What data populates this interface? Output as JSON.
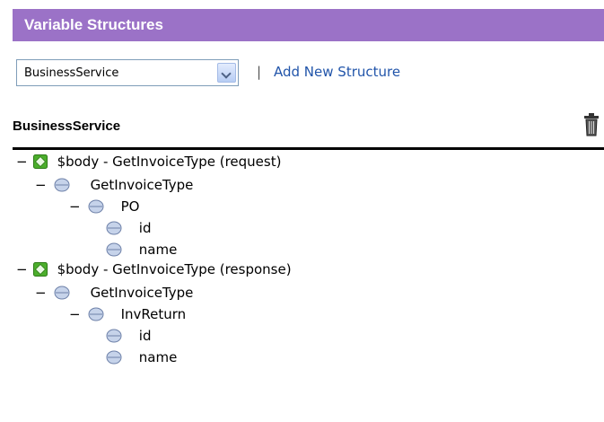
{
  "header": {
    "title": "Variable Structures"
  },
  "toolbar": {
    "selected_structure": "BusinessService",
    "separator": "|",
    "add_link": "Add New Structure"
  },
  "section": {
    "name": "BusinessService"
  },
  "tree": {
    "request_root": "$body - GetInvoiceType (request)",
    "request_type": "GetInvoiceType",
    "request_po": "PO",
    "request_id": "id",
    "request_name": "name",
    "response_root": "$body - GetInvoiceType (response)",
    "response_type": "GetInvoiceType",
    "response_return": "InvReturn",
    "response_id": "id",
    "response_name": "name",
    "collapse_glyph": "−"
  },
  "colors": {
    "header_bg": "#9b72c7",
    "link": "#2255aa"
  }
}
